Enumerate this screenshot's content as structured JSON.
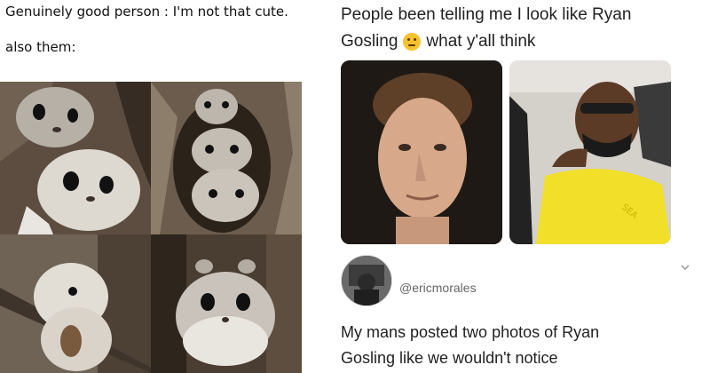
{
  "left_meme": {
    "caption_line1": "Genuinely good person : I'm not that cute.",
    "caption_line2": "also them:"
  },
  "tweet": {
    "text_line1": "People been telling me I look like Ryan",
    "text_line2": "Gosling",
    "text_line2_tail": "what y'all think",
    "reply_handle": "@ericmorales",
    "reply_line1": "My mans posted two photos of Ryan",
    "reply_line2": "Gosling like we wouldn't notice"
  },
  "icons": {
    "thinking_emoji": "thinking-face-emoji",
    "chevron": "chevron-down-icon"
  },
  "colors": {
    "shirt_yellow": "#f2df2a",
    "squirrel_fur": "#c9c3bb"
  }
}
